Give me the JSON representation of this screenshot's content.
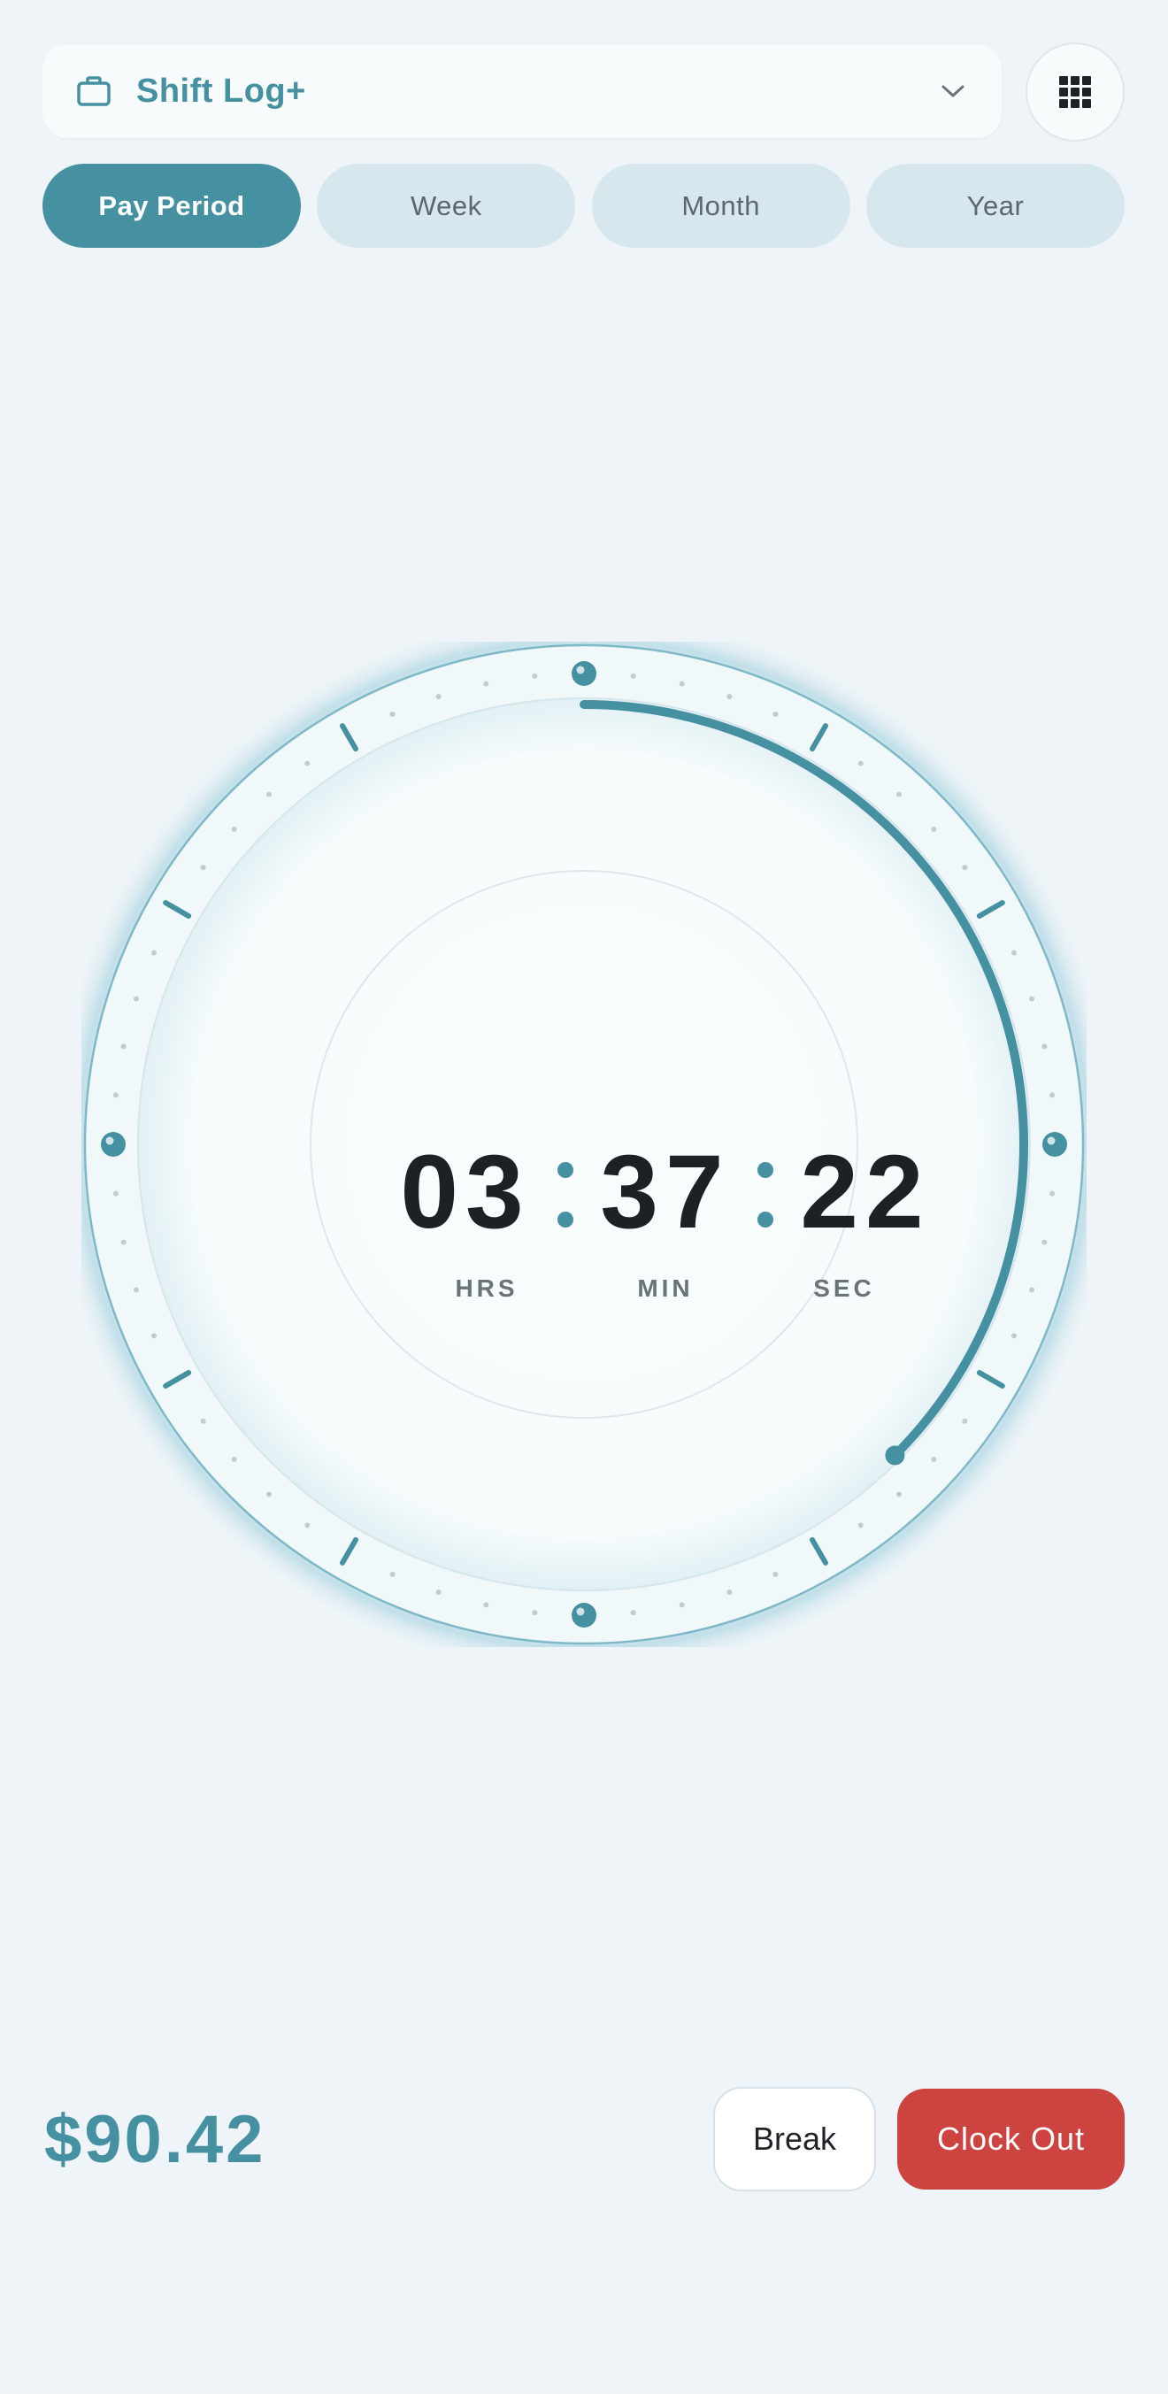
{
  "header": {
    "job_name": "Shift Log+",
    "job_icon": "briefcase-icon",
    "dropdown_icon": "chevron-down-icon",
    "menu_icon": "grid-icon"
  },
  "tabs": [
    {
      "label": "Pay Period",
      "active": true
    },
    {
      "label": "Week",
      "active": false
    },
    {
      "label": "Month",
      "active": false
    },
    {
      "label": "Year",
      "active": false
    }
  ],
  "timer": {
    "hours": "03",
    "minutes": "37",
    "seconds": "22",
    "hours_label": "HRS",
    "minutes_label": "MIN",
    "seconds_label": "SEC",
    "progress": 0.375
  },
  "footer": {
    "earnings": "$90.42",
    "break_label": "Break",
    "clock_out_label": "Clock Out"
  },
  "colors": {
    "accent": "#4591a1",
    "danger": "#cd4340",
    "background": "#eef4f7",
    "text_dark": "#1c2126"
  }
}
